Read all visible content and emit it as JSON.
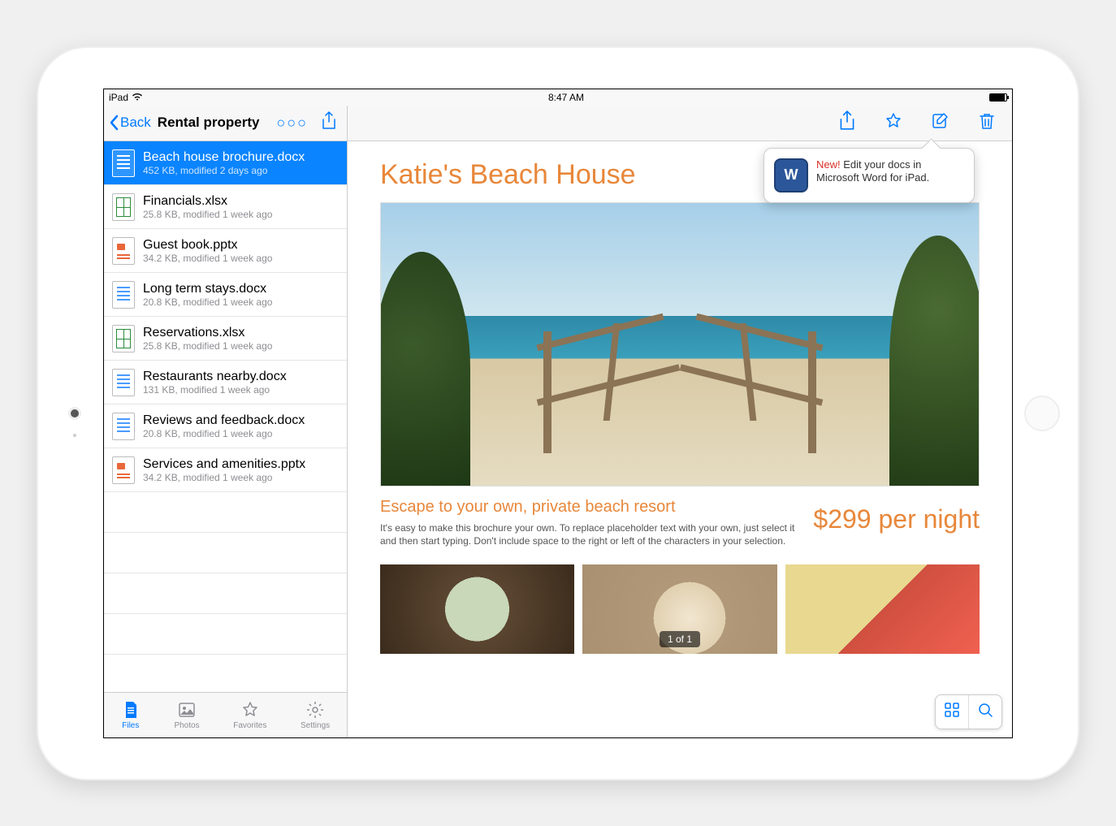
{
  "status": {
    "carrier": "iPad",
    "time": "8:47 AM"
  },
  "leftHeader": {
    "back": "Back",
    "title": "Rental property"
  },
  "files": [
    {
      "name": "Beach house brochure.docx",
      "meta": "452 KB, modified 2 days ago",
      "type": "doc",
      "selected": true
    },
    {
      "name": "Financials.xlsx",
      "meta": "25.8 KB, modified 1 week ago",
      "type": "xls",
      "selected": false
    },
    {
      "name": "Guest book.pptx",
      "meta": "34.2 KB, modified 1 week ago",
      "type": "ppt",
      "selected": false
    },
    {
      "name": "Long term stays.docx",
      "meta": "20.8 KB, modified 1 week ago",
      "type": "doc",
      "selected": false
    },
    {
      "name": "Reservations.xlsx",
      "meta": "25.8 KB, modified 1 week ago",
      "type": "xls",
      "selected": false
    },
    {
      "name": "Restaurants nearby.docx",
      "meta": "131 KB, modified 1 week ago",
      "type": "doc",
      "selected": false
    },
    {
      "name": "Reviews and feedback.docx",
      "meta": "20.8 KB, modified 1 week ago",
      "type": "doc",
      "selected": false
    },
    {
      "name": "Services and amenities.pptx",
      "meta": "34.2 KB, modified 1 week ago",
      "type": "ppt",
      "selected": false
    }
  ],
  "tabs": {
    "files": "Files",
    "photos": "Photos",
    "favorites": "Favorites",
    "settings": "Settings"
  },
  "popover": {
    "new": "New!",
    "text": " Edit your docs in Microsoft Word for iPad.",
    "badge": "W"
  },
  "doc": {
    "title": "Katie's Beach House",
    "subtitle": "Escape to your own, private beach resort",
    "body": "It's easy to make this brochure your own. To replace placeholder text with your own, just select it and then start typing. Don't include space to the right or left of the characters in your selection.",
    "price": "$299 per night",
    "pageIndicator": "1 of 1"
  }
}
